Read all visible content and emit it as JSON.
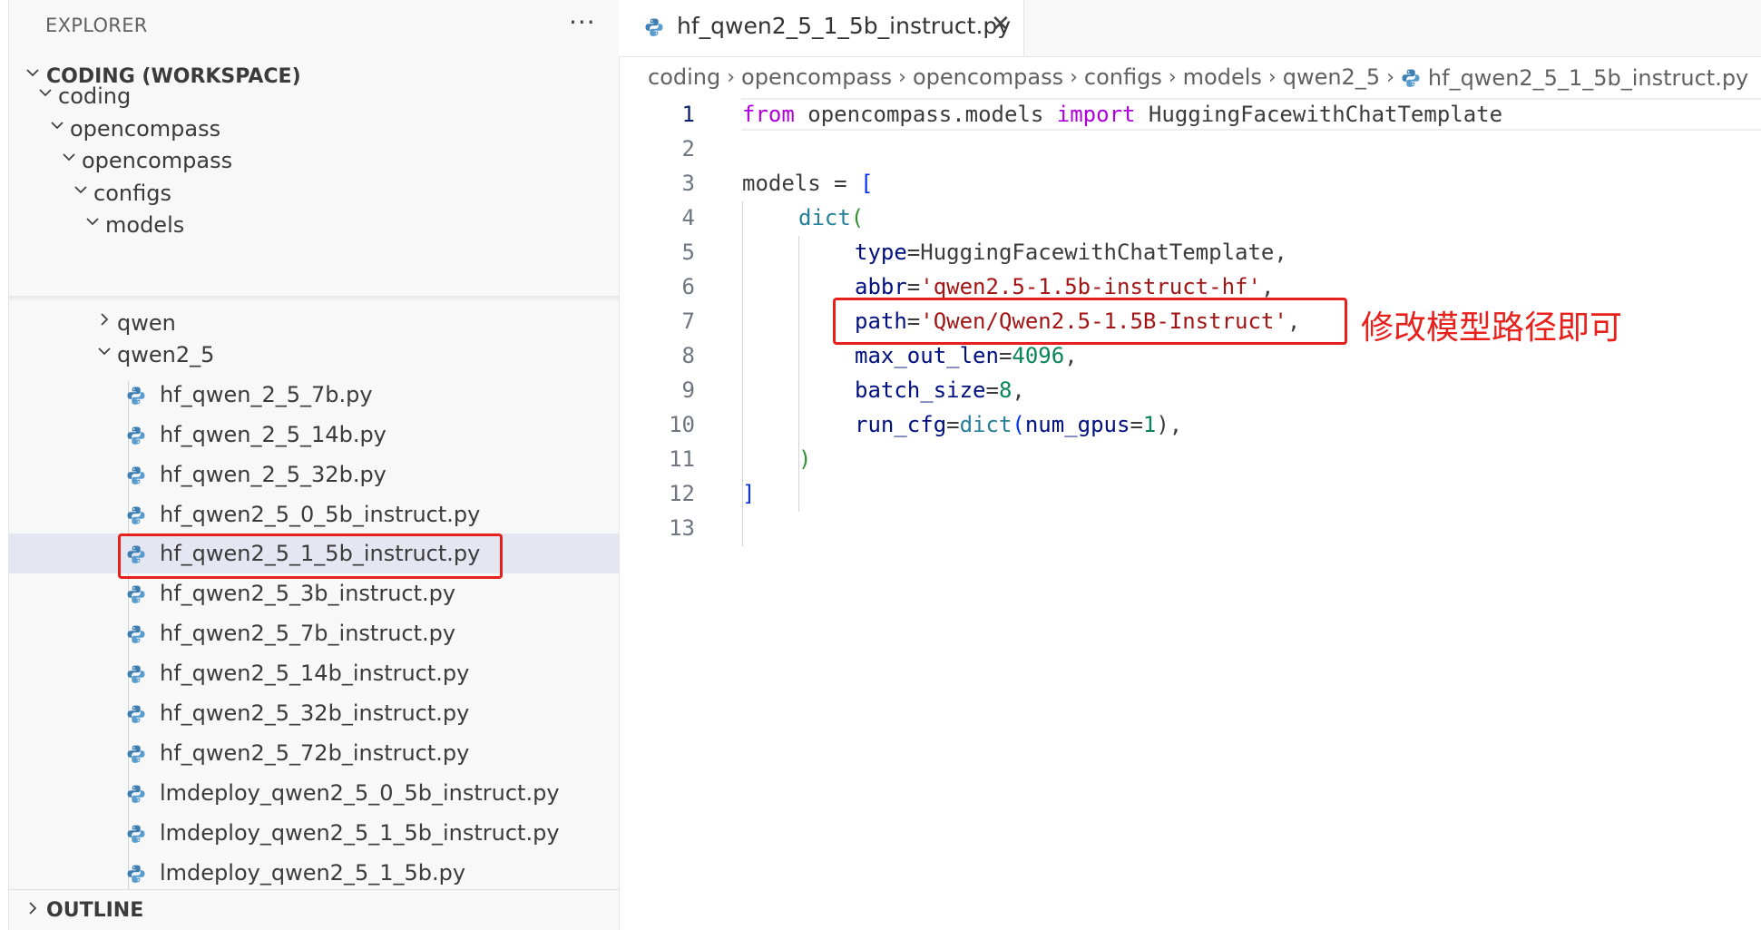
{
  "explorer": {
    "title": "EXPLORER",
    "more_label": "···",
    "workspace_label": "CODING (WORKSPACE)",
    "tree": [
      {
        "label": "coding"
      },
      {
        "label": "opencompass"
      },
      {
        "label": "opencompass"
      },
      {
        "label": "configs"
      },
      {
        "label": "models"
      },
      {
        "label": "qwen"
      },
      {
        "label": "qwen2_5"
      },
      {
        "label": "hf_qwen_2_5_7b.py"
      },
      {
        "label": "hf_qwen_2_5_14b.py"
      },
      {
        "label": "hf_qwen_2_5_32b.py"
      },
      {
        "label": "hf_qwen2_5_0_5b_instruct.py"
      },
      {
        "label": "hf_qwen2_5_1_5b_instruct.py",
        "selected": true
      },
      {
        "label": "hf_qwen2_5_3b_instruct.py"
      },
      {
        "label": "hf_qwen2_5_7b_instruct.py"
      },
      {
        "label": "hf_qwen2_5_14b_instruct.py"
      },
      {
        "label": "hf_qwen2_5_32b_instruct.py"
      },
      {
        "label": "hf_qwen2_5_72b_instruct.py"
      },
      {
        "label": "lmdeploy_qwen2_5_0_5b_instruct.py"
      },
      {
        "label": "lmdeploy_qwen2_5_1_5b_instruct.py"
      },
      {
        "label": "lmdeploy_qwen2_5_1_5b.py"
      }
    ],
    "outline_label": "OUTLINE"
  },
  "editor": {
    "tab_label": "hf_qwen2_5_1_5b_instruct.py",
    "close_glyph": "✕",
    "breadcrumb": [
      "coding",
      "opencompass",
      "opencompass",
      "configs",
      "models",
      "qwen2_5"
    ],
    "breadcrumb_file": "hf_qwen2_5_1_5b_instruct.py",
    "line_numbers": [
      "1",
      "2",
      "3",
      "4",
      "5",
      "6",
      "7",
      "8",
      "9",
      "10",
      "11",
      "12",
      "13"
    ],
    "code": {
      "l1_from": "from",
      "l1_module": " opencompass.models ",
      "l1_import": "import",
      "l1_name": " HuggingFacewithChatTemplate",
      "l3_var": "models",
      "l3_eq": " = ",
      "l3_br": "[",
      "l4_fn": "dict",
      "l4_br": "(",
      "l5_key": "type",
      "l5_val": "=HuggingFacewithChatTemplate,",
      "l6_key": "abbr",
      "l6_eq": "=",
      "l6_str": "'qwen2.5-1.5b-instruct-hf'",
      "l6_comma": ",",
      "l7_key": "path",
      "l7_eq": "=",
      "l7_str": "'Qwen/Qwen2.5-1.5B-Instruct'",
      "l7_comma": ",",
      "l8_key": "max_out_len",
      "l8_eq": "=",
      "l8_num": "4096",
      "l8_comma": ",",
      "l9_key": "batch_size",
      "l9_eq": "=",
      "l9_num": "8",
      "l9_comma": ",",
      "l10_key": "run_cfg",
      "l10_eq": "=",
      "l10_fn": "dict",
      "l10_br_open": "(",
      "l10_key2": "num_gpus",
      "l10_eq2": "=",
      "l10_num": "1",
      "l10_tail": "),",
      "l11_br": ")",
      "l12_br": "]"
    },
    "annotation": "修改模型路径即可"
  },
  "colors": {
    "highlight": "#e8201c",
    "selection": "#e4e6f1"
  }
}
